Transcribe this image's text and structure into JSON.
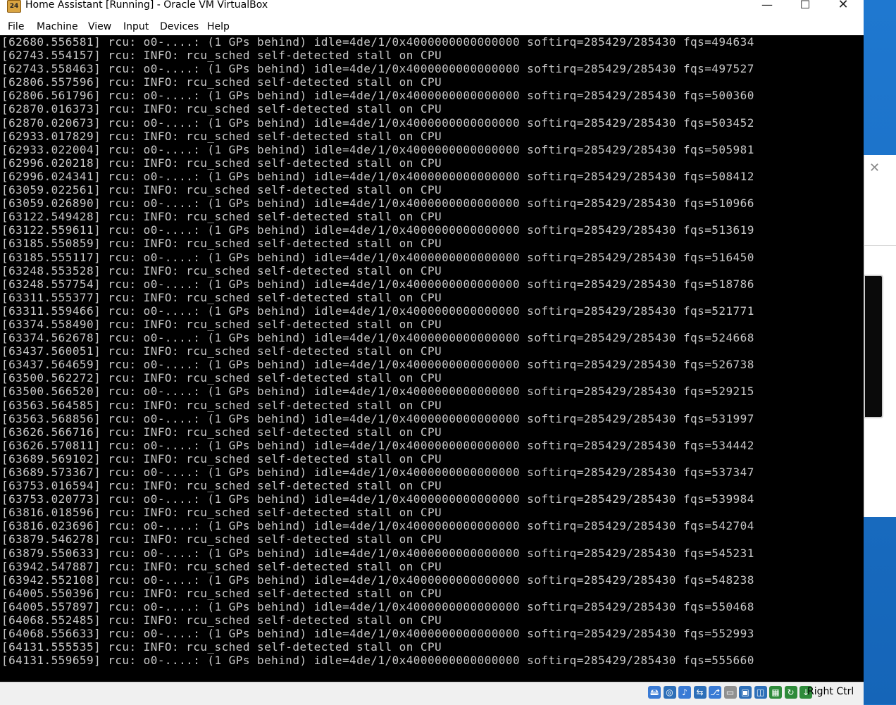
{
  "window": {
    "title": "Home Assistant [Running] - Oracle VM VirtualBox",
    "app_icon": "virtualbox-icon",
    "minimize": "—",
    "maximize": "☐",
    "close": "✕"
  },
  "menu": [
    "File",
    "Machine",
    "View",
    "Input",
    "Devices",
    "Help"
  ],
  "console": {
    "lines": [
      "[62680.556581] rcu: o0-....: (1 GPs behind) idle=4de/1/0x4000000000000000 softirq=285429/285430 fqs=494634",
      "[62743.554157] rcu: INFO: rcu_sched self-detected stall on CPU",
      "[62743.558463] rcu: o0-....: (1 GPs behind) idle=4de/1/0x4000000000000000 softirq=285429/285430 fqs=497527",
      "[62806.557596] rcu: INFO: rcu_sched self-detected stall on CPU",
      "[62806.561796] rcu: o0-....: (1 GPs behind) idle=4de/1/0x4000000000000000 softirq=285429/285430 fqs=500360",
      "[62870.016373] rcu: INFO: rcu_sched self-detected stall on CPU",
      "[62870.020673] rcu: o0-....: (1 GPs behind) idle=4de/1/0x4000000000000000 softirq=285429/285430 fqs=503452",
      "[62933.017829] rcu: INFO: rcu_sched self-detected stall on CPU",
      "[62933.022004] rcu: o0-....: (1 GPs behind) idle=4de/1/0x4000000000000000 softirq=285429/285430 fqs=505981",
      "[62996.020218] rcu: INFO: rcu_sched self-detected stall on CPU",
      "[62996.024341] rcu: o0-....: (1 GPs behind) idle=4de/1/0x4000000000000000 softirq=285429/285430 fqs=508412",
      "[63059.022561] rcu: INFO: rcu_sched self-detected stall on CPU",
      "[63059.026890] rcu: o0-....: (1 GPs behind) idle=4de/1/0x4000000000000000 softirq=285429/285430 fqs=510966",
      "[63122.549428] rcu: INFO: rcu_sched self-detected stall on CPU",
      "[63122.559611] rcu: o0-....: (1 GPs behind) idle=4de/1/0x4000000000000000 softirq=285429/285430 fqs=513619",
      "[63185.550859] rcu: INFO: rcu_sched self-detected stall on CPU",
      "[63185.555117] rcu: o0-....: (1 GPs behind) idle=4de/1/0x4000000000000000 softirq=285429/285430 fqs=516450",
      "[63248.553528] rcu: INFO: rcu_sched self-detected stall on CPU",
      "[63248.557754] rcu: o0-....: (1 GPs behind) idle=4de/1/0x4000000000000000 softirq=285429/285430 fqs=518786",
      "[63311.555377] rcu: INFO: rcu_sched self-detected stall on CPU",
      "[63311.559466] rcu: o0-....: (1 GPs behind) idle=4de/1/0x4000000000000000 softirq=285429/285430 fqs=521771",
      "[63374.558490] rcu: INFO: rcu_sched self-detected stall on CPU",
      "[63374.562678] rcu: o0-....: (1 GPs behind) idle=4de/1/0x4000000000000000 softirq=285429/285430 fqs=524668",
      "[63437.560051] rcu: INFO: rcu_sched self-detected stall on CPU",
      "[63437.564659] rcu: o0-....: (1 GPs behind) idle=4de/1/0x4000000000000000 softirq=285429/285430 fqs=526738",
      "[63500.562272] rcu: INFO: rcu_sched self-detected stall on CPU",
      "[63500.566520] rcu: o0-....: (1 GPs behind) idle=4de/1/0x4000000000000000 softirq=285429/285430 fqs=529215",
      "[63563.564585] rcu: INFO: rcu_sched self-detected stall on CPU",
      "[63563.568856] rcu: o0-....: (1 GPs behind) idle=4de/1/0x4000000000000000 softirq=285429/285430 fqs=531997",
      "[63626.566716] rcu: INFO: rcu_sched self-detected stall on CPU",
      "[63626.570811] rcu: o0-....: (1 GPs behind) idle=4de/1/0x4000000000000000 softirq=285429/285430 fqs=534442",
      "[63689.569102] rcu: INFO: rcu_sched self-detected stall on CPU",
      "[63689.573367] rcu: o0-....: (1 GPs behind) idle=4de/1/0x4000000000000000 softirq=285429/285430 fqs=537347",
      "[63753.016594] rcu: INFO: rcu_sched self-detected stall on CPU",
      "[63753.020773] rcu: o0-....: (1 GPs behind) idle=4de/1/0x4000000000000000 softirq=285429/285430 fqs=539984",
      "[63816.018596] rcu: INFO: rcu_sched self-detected stall on CPU",
      "[63816.023696] rcu: o0-....: (1 GPs behind) idle=4de/1/0x4000000000000000 softirq=285429/285430 fqs=542704",
      "[63879.546278] rcu: INFO: rcu_sched self-detected stall on CPU",
      "[63879.550633] rcu: o0-....: (1 GPs behind) idle=4de/1/0x4000000000000000 softirq=285429/285430 fqs=545231",
      "[63942.547887] rcu: INFO: rcu_sched self-detected stall on CPU",
      "[63942.552108] rcu: o0-....: (1 GPs behind) idle=4de/1/0x4000000000000000 softirq=285429/285430 fqs=548238",
      "[64005.550396] rcu: INFO: rcu_sched self-detected stall on CPU",
      "[64005.557897] rcu: o0-....: (1 GPs behind) idle=4de/1/0x4000000000000000 softirq=285429/285430 fqs=550468",
      "[64068.552485] rcu: INFO: rcu_sched self-detected stall on CPU",
      "[64068.556633] rcu: o0-....: (1 GPs behind) idle=4de/1/0x4000000000000000 softirq=285429/285430 fqs=552993",
      "[64131.555535] rcu: INFO: rcu_sched self-detected stall on CPU",
      "[64131.559659] rcu: o0-....: (1 GPs behind) idle=4de/1/0x4000000000000000 softirq=285429/285430 fqs=555660"
    ]
  },
  "statusbar": {
    "icons": [
      {
        "name": "hard-disk-icon",
        "glyph": "🖴",
        "color": "#3a7bd5"
      },
      {
        "name": "optical-drive-icon",
        "glyph": "◎",
        "color": "#2d6fb8"
      },
      {
        "name": "audio-icon",
        "glyph": "♪",
        "color": "#3a7bd5"
      },
      {
        "name": "network-icon",
        "glyph": "⇆",
        "color": "#2d6fb8"
      },
      {
        "name": "usb-icon",
        "glyph": "⎇",
        "color": "#3a7bd5"
      },
      {
        "name": "shared-folders-icon",
        "glyph": "▭",
        "color": "#909090"
      },
      {
        "name": "display-icon",
        "glyph": "▣",
        "color": "#2d6fb8"
      },
      {
        "name": "video-capture-icon",
        "glyph": "◫",
        "color": "#2d6fb8"
      },
      {
        "name": "cpu-icon",
        "glyph": "▦",
        "color": "#2e8b3a"
      },
      {
        "name": "mouse-integration-icon",
        "glyph": "↻",
        "color": "#2e8b3a"
      },
      {
        "name": "keyboard-capture-icon",
        "glyph": "↓",
        "color": "#2e8b3a"
      }
    ],
    "host_key": "Right Ctrl"
  },
  "side_panel": {
    "close": "✕"
  }
}
